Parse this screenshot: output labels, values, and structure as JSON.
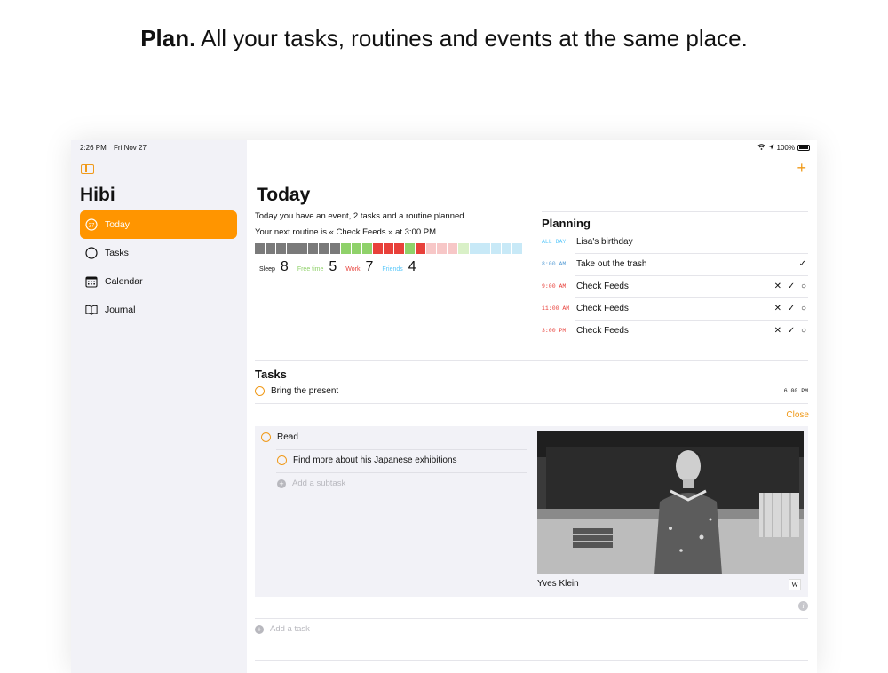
{
  "headline": {
    "bold": "Plan.",
    "rest": " All your tasks, routines and events at the same place."
  },
  "status_bar": {
    "time": "2:26 PM",
    "date": "Fri Nov 27",
    "battery": "100%"
  },
  "sidebar": {
    "app_title": "Hibi",
    "today_badge": "27",
    "items": [
      {
        "label": "Today",
        "icon": "calendar-day-icon",
        "active": true
      },
      {
        "label": "Tasks",
        "icon": "circle-icon",
        "active": false
      },
      {
        "label": "Calendar",
        "icon": "calendar-grid-icon",
        "active": false
      },
      {
        "label": "Journal",
        "icon": "book-icon",
        "active": false
      }
    ]
  },
  "main": {
    "title": "Today",
    "summary": "Today you have an event, 2 tasks and a routine planned.",
    "next_routine": "Your next routine is « Check Feeds » at 3:00 PM.",
    "stats": [
      {
        "label": "Sleep",
        "value": "8",
        "color": "#111111"
      },
      {
        "label": "Free time",
        "value": "5",
        "color": "#8fd16a"
      },
      {
        "label": "Work",
        "value": "7",
        "color": "#e8403a"
      },
      {
        "label": "Friends",
        "value": "4",
        "color": "#5ac8fa"
      }
    ],
    "timebar_colors": [
      "#7a7a7a",
      "#7a7a7a",
      "#7a7a7a",
      "#7a7a7a",
      "#7a7a7a",
      "#7a7a7a",
      "#7a7a7a",
      "#7a7a7a",
      "#8fd16a",
      "#8fd16a",
      "#8fd16a",
      "#e8403a",
      "#e8403a",
      "#e8403a",
      "#8fd16a",
      "#e8403a",
      "#f7c7c7",
      "#f7c7c7",
      "#f7c7c7",
      "#d9f0c7",
      "#c8e9f7",
      "#c8e9f7",
      "#c8e9f7",
      "#c8e9f7",
      "#c8e9f7"
    ]
  },
  "planning": {
    "title": "Planning",
    "rows": [
      {
        "time": "ALL DAY",
        "time_color": "#5ac8fa",
        "title": "Lisa's birthday",
        "actions": ""
      },
      {
        "time": "8:00 AM",
        "time_color": "#5a9fd6",
        "title": "Take out the trash",
        "actions": "✓"
      },
      {
        "time": "9:00 AM",
        "time_color": "#e8403a",
        "title": "Check Feeds",
        "actions": "✕ ✓ ○"
      },
      {
        "time": "11:00 AM",
        "time_color": "#e8403a",
        "title": "Check Feeds",
        "actions": "✕ ✓ ○"
      },
      {
        "time": "3:00 PM",
        "time_color": "#e8403a",
        "title": "Check Feeds",
        "actions": "✕ ✓ ○"
      }
    ]
  },
  "tasks": {
    "title": "Tasks",
    "first_task": {
      "label": "Bring the present",
      "time": "6:00 PM"
    },
    "close_label": "Close",
    "detail": {
      "task": "Read",
      "subtask": "Find more about his Japanese exhibitions",
      "add_subtask": "Add a subtask",
      "photo_caption": "Yves Klein",
      "wiki_badge": "W"
    },
    "add_task": "Add a task"
  },
  "colors": {
    "accent": "#ff9500",
    "sidebar_bg": "#f2f2f7"
  }
}
